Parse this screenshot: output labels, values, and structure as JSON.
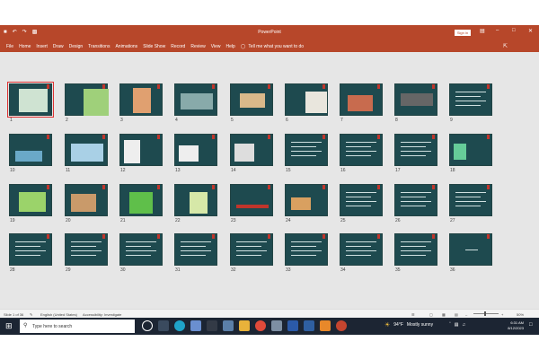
{
  "titlebar": {
    "app_title": "PowerPoint",
    "signin": "Sign in",
    "qat": [
      "save",
      "undo",
      "redo",
      "present"
    ],
    "window_controls": [
      "minimize",
      "restore",
      "close"
    ]
  },
  "ribbon": {
    "tabs": [
      "File",
      "Home",
      "Insert",
      "Draw",
      "Design",
      "Transitions",
      "Animations",
      "Slide Show",
      "Record",
      "Review",
      "View",
      "Help"
    ],
    "tell_me": "Tell me what you want to do"
  },
  "slides": [
    {
      "n": "1"
    },
    {
      "n": "2"
    },
    {
      "n": "3"
    },
    {
      "n": "4"
    },
    {
      "n": "5"
    },
    {
      "n": "6"
    },
    {
      "n": "7"
    },
    {
      "n": "8"
    },
    {
      "n": "9"
    },
    {
      "n": "10"
    },
    {
      "n": "11"
    },
    {
      "n": "12"
    },
    {
      "n": "13"
    },
    {
      "n": "14"
    },
    {
      "n": "15"
    },
    {
      "n": "16"
    },
    {
      "n": "17"
    },
    {
      "n": "18"
    },
    {
      "n": "19"
    },
    {
      "n": "20"
    },
    {
      "n": "21"
    },
    {
      "n": "22"
    },
    {
      "n": "23"
    },
    {
      "n": "24"
    },
    {
      "n": "25"
    },
    {
      "n": "26"
    },
    {
      "n": "27"
    },
    {
      "n": "28"
    },
    {
      "n": "29"
    },
    {
      "n": "30"
    },
    {
      "n": "31"
    },
    {
      "n": "32"
    },
    {
      "n": "33"
    },
    {
      "n": "34"
    },
    {
      "n": "35"
    },
    {
      "n": "36"
    }
  ],
  "status": {
    "slide_of": "Slide 1 of 36",
    "language": "English (United States)",
    "accessibility": "Accessibility: Investigate",
    "zoom": "50%"
  },
  "taskbar": {
    "search_placeholder": "Type here to search",
    "weather_temp": "94°F",
    "weather_text": "Mostly sunny",
    "time": "6:31 AM",
    "date": "8/12/2023"
  },
  "colors": {
    "accent": "#b7472a",
    "slide_bg": "#1e4a4f",
    "taskbar": "#1c2533"
  }
}
